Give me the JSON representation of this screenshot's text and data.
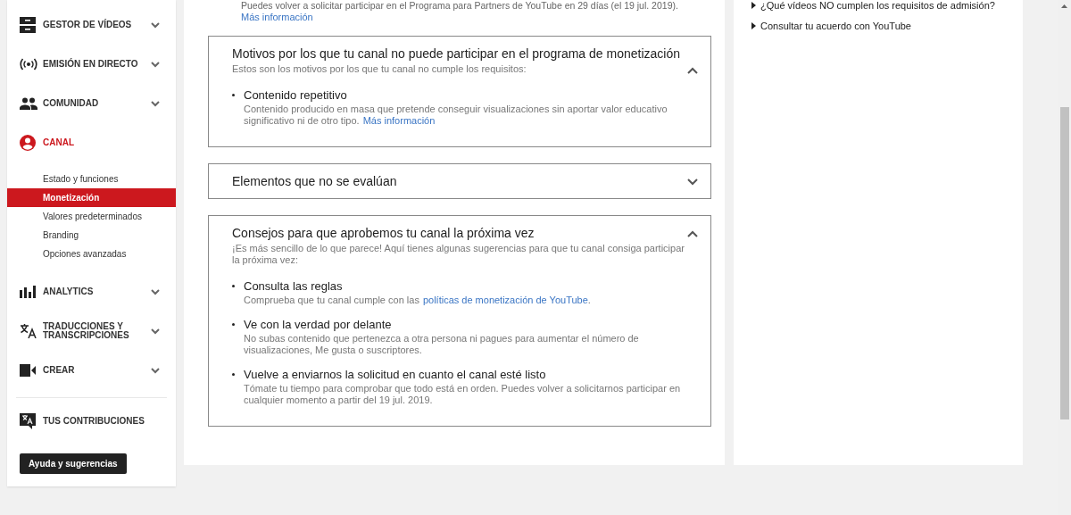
{
  "sidebar": {
    "items": [
      {
        "kind": "videos",
        "label": "GESTOR DE VÍDEOS",
        "selected": false,
        "expanded": false
      },
      {
        "kind": "live",
        "label": "EMISIÓN EN DIRECTO",
        "selected": false,
        "expanded": false
      },
      {
        "kind": "community",
        "label": "COMUNIDAD",
        "selected": false,
        "expanded": false
      },
      {
        "kind": "channel",
        "label": "CANAL",
        "selected": true,
        "expanded": true,
        "children": [
          {
            "label": "Estado y funciones",
            "selected": false
          },
          {
            "label": "Monetización",
            "selected": true
          },
          {
            "label": "Valores predeterminados",
            "selected": false
          },
          {
            "label": "Branding",
            "selected": false
          },
          {
            "label": "Opciones avanzadas",
            "selected": false
          }
        ]
      },
      {
        "kind": "analytics",
        "label": "ANALYTICS",
        "selected": false,
        "expanded": false
      },
      {
        "kind": "translate",
        "label": "TRADUCCIONES Y TRANSCRIPCIONES",
        "selected": false,
        "expanded": false
      },
      {
        "kind": "create",
        "label": "CREAR",
        "selected": false,
        "expanded": false
      }
    ],
    "footer_item": {
      "label": "TUS CONTRIBUCIONES"
    },
    "help_button": "Ayuda y sugerencias"
  },
  "notice": {
    "text": "Puedes volver a solicitar participar en el Programa para Partners de YouTube en 29 días (el 19 jul. 2019).",
    "link": "Más información"
  },
  "panels": [
    {
      "title": "Motivos por los que tu canal no puede participar en el programa de monetización",
      "subtitle": "Estos son los motivos por los que tu canal no cumple los requisitos:",
      "expanded": true,
      "items": [
        {
          "title": "Contenido repetitivo",
          "text": "Contenido producido en masa que pretende conseguir visualizaciones sin aportar valor educativo significativo ni de otro tipo.",
          "link": "Más información"
        }
      ]
    },
    {
      "title": "Elementos que no se evalúan",
      "expanded": false
    },
    {
      "title": "Consejos para que aprobemos tu canal la próxima vez",
      "subtitle": "¡Es más sencillo de lo que parece! Aquí tienes algunas sugerencias para que tu canal consiga participar la próxima vez:",
      "expanded": true,
      "items": [
        {
          "title": "Consulta las reglas",
          "text": "Comprueba que tu canal cumple con las",
          "link": "políticas de monetización de YouTube",
          "after": "."
        },
        {
          "title": "Ve con la verdad por delante",
          "text": "No subas contenido que pertenezca a otra persona ni pagues para aumentar el número de visualizaciones, Me gusta o suscriptores."
        },
        {
          "title": "Vuelve a enviarnos la solicitud en cuanto el canal esté listo",
          "text": "Tómate tu tiempo para comprobar que todo está en orden. Puedes volver a solicitarnos participar en cualquier momento a partir del 19 jul. 2019."
        }
      ]
    }
  ],
  "help_links": [
    "¿Qué vídeos NO cumplen los requisitos de admisión?",
    "Consultar tu acuerdo con YouTube"
  ]
}
